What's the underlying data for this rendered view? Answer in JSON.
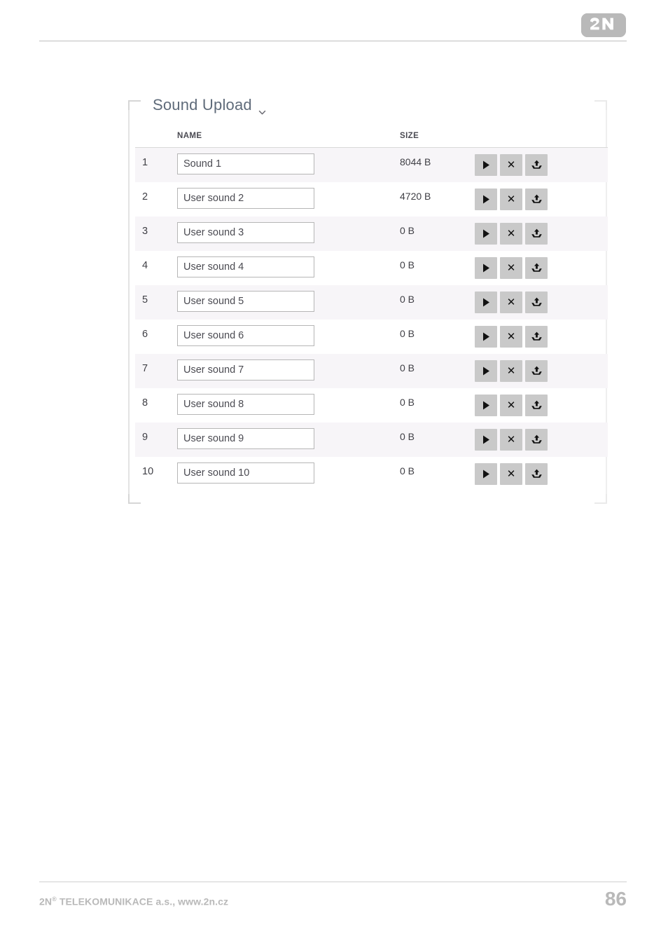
{
  "header": {
    "logo_text": "2N",
    "logo_name": "2n-logo",
    "logo_color": "#b9b9b9"
  },
  "panel": {
    "title": "Sound Upload",
    "chevron_icon": "chevron-down-icon"
  },
  "table": {
    "columns": {
      "index": "",
      "name": "NAME",
      "size": "SIZE"
    },
    "actions": {
      "play_label": "play-icon",
      "delete_label": "close-icon",
      "upload_label": "upload-icon"
    },
    "rows": [
      {
        "index": "1",
        "name": "Sound 1",
        "size": "8044 B"
      },
      {
        "index": "2",
        "name": "User sound 2",
        "size": "4720 B"
      },
      {
        "index": "3",
        "name": "User sound 3",
        "size": "0 B"
      },
      {
        "index": "4",
        "name": "User sound 4",
        "size": "0 B"
      },
      {
        "index": "5",
        "name": "User sound 5",
        "size": "0 B"
      },
      {
        "index": "6",
        "name": "User sound 6",
        "size": "0 B"
      },
      {
        "index": "7",
        "name": "User sound 7",
        "size": "0 B"
      },
      {
        "index": "8",
        "name": "User sound 8",
        "size": "0 B"
      },
      {
        "index": "9",
        "name": "User sound 9",
        "size": "0 B"
      },
      {
        "index": "10",
        "name": "User sound 10",
        "size": "0 B"
      }
    ]
  },
  "footer": {
    "company": "2N",
    "registered_mark": "®",
    "company_rest": " TELEKOMUNIKACE a.s., www.2n.cz",
    "page_number": "86"
  },
  "colors": {
    "stripe": "#f7f5f8",
    "button_gray": "#c9c9c9",
    "title_gray": "#5f6b7a",
    "footer_gray": "#b9b9b9"
  }
}
